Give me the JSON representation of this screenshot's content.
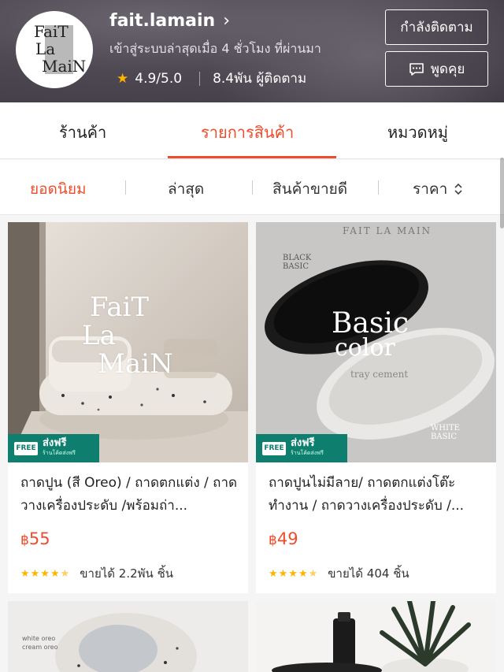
{
  "shop": {
    "logo_text": "FaiT La MaiN",
    "name": "fait.lamain",
    "last_active": "เข้าสู่ระบบล่าสุดเมื่อ 4 ชั่วโมง ที่ผ่านมา",
    "rating": "4.9/5.0",
    "followers": "8.4พัน ผู้ติดตาม",
    "follow_label": "กำลังติดตาม",
    "chat_label": "พูดคุย"
  },
  "tabs": [
    {
      "label": "ร้านค้า"
    },
    {
      "label": "รายการสินค้า",
      "active": true
    },
    {
      "label": "หมวดหมู่"
    }
  ],
  "sort": [
    {
      "label": "ยอดนิยม",
      "active": true
    },
    {
      "label": "ล่าสุด"
    },
    {
      "label": "สินค้าขายดี"
    },
    {
      "label": "ราคา"
    }
  ],
  "products": [
    {
      "title": "ถาดปูน (สี Oreo) / ถาดตกแต่ง / ถาดวางเครื่องประดับ /พร้อมถ่า...",
      "currency": "฿",
      "price": "55",
      "sold": "ขายได้ 2.2พัน ชิ้น",
      "badge_free": "FREE",
      "badge_ship": "ส่งฟรี",
      "badge_sub": "ร้านโค้ดส่งฟรี",
      "image_text": [
        "FaiT",
        "La",
        "MaiN"
      ]
    },
    {
      "title": "ถาดปูนไม่มีลาย/ ถาดตกแต่งโต๊ะทำงาน / ถาดวางเครื่องประดับ /...",
      "currency": "฿",
      "price": "49",
      "sold": "ขายได้ 404 ชิ้น",
      "badge_free": "FREE",
      "badge_ship": "ส่งฟรี",
      "badge_sub": "ร้านโค้ดส่งฟรี",
      "image_text": [
        "FAIT LA MAIN",
        "BLACK",
        "BASIC",
        "Basic",
        "color",
        "tray cement",
        "WHITE",
        "BASIC"
      ]
    },
    {
      "image_text": [
        "white oreo",
        "cream oreo"
      ]
    },
    {}
  ],
  "colors": {
    "accent": "#ee4d2d",
    "badge_green": "#0e7f6e",
    "star": "#ffb400"
  }
}
